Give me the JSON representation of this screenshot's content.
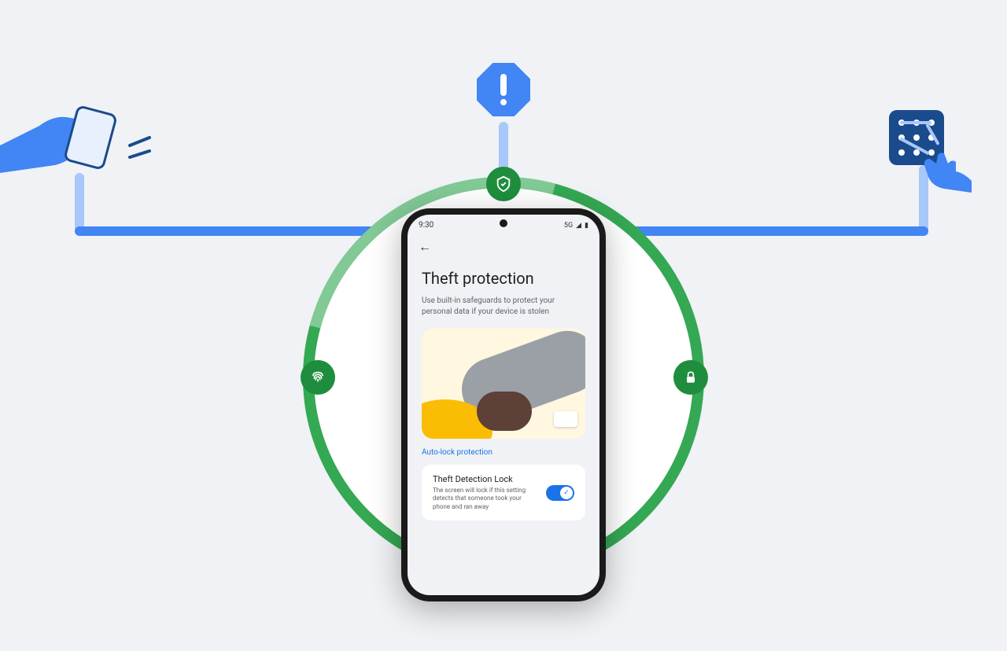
{
  "phone": {
    "status_time": "9:30",
    "status_network": "5G",
    "title": "Theft protection",
    "subtitle": "Use built-in safeguards to protect your personal data if your device is stolen",
    "section_label": "Auto-lock protection",
    "setting": {
      "title": "Theft Detection Lock",
      "desc": "The screen will lock if this setting detects that someone took your phone and ran away",
      "enabled": true
    }
  },
  "icons": {
    "alert": "alert-icon",
    "shield": "shield-icon",
    "fingerprint": "fingerprint-icon",
    "lock": "lock-icon",
    "keypad": "keypad-icon",
    "hand_phone": "hand-phone-icon"
  }
}
